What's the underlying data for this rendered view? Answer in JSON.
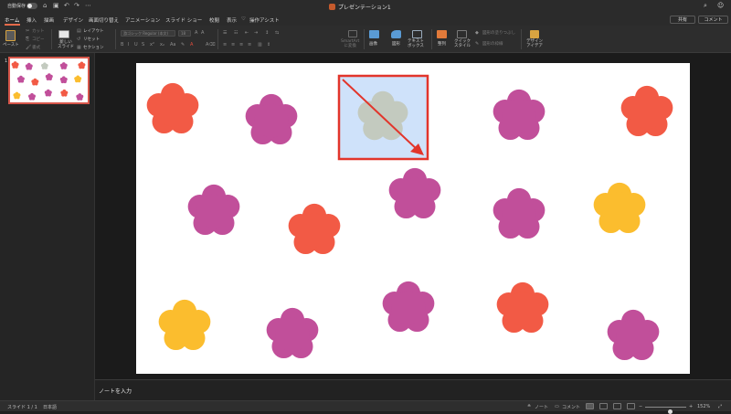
{
  "titlebar": {
    "autosave_label": "自動保存",
    "autosave_state": "オフ",
    "doc_title": "プレゼンテーション1",
    "icons": [
      "home-icon",
      "save-icon",
      "undo-icon",
      "redo-icon",
      "more-icon"
    ]
  },
  "tabs": [
    {
      "label": "ホーム",
      "active": true
    },
    {
      "label": "挿入",
      "active": false
    },
    {
      "label": "描画",
      "active": false
    },
    {
      "label": "デザイン",
      "active": false
    },
    {
      "label": "画面切り替え",
      "active": false
    },
    {
      "label": "アニメーション",
      "active": false
    },
    {
      "label": "スライド ショー",
      "active": false
    },
    {
      "label": "校閲",
      "active": false
    },
    {
      "label": "表示",
      "active": false
    },
    {
      "label": "操作アシスト",
      "active": false
    }
  ],
  "share": {
    "share_label": "共有",
    "comment_label": "コメント"
  },
  "ribbon": {
    "paste": "ペースト",
    "cut": "カット",
    "copy": "コピー",
    "format": "書式",
    "new_slide": "新しい\nスライド",
    "layout": "レイアウト",
    "reset": "リセット",
    "section": "セクション",
    "font_name": "游ゴシック Regular (本文)",
    "font_size": "18",
    "smartart": "SmartArt\nに変換",
    "image": "画像",
    "shape": "図形",
    "textbox": "テキスト\nボックス",
    "arrange": "整列",
    "quick_style": "クイック\nスタイル",
    "shape_fill": "図形の塗りつぶし",
    "shape_outline": "図形の枠線",
    "design_ideas": "デザイン\nアイデア"
  },
  "thumbnail": {
    "number": "1"
  },
  "slide": {
    "flowers": [
      {
        "color": "#f25a45"
      },
      {
        "color": "#c14f9a"
      },
      {
        "color": "#c14f9a"
      },
      {
        "color": "#f25a45"
      },
      {
        "color": "#c14f9a"
      },
      {
        "color": "#f25a45"
      },
      {
        "color": "#c14f9a"
      },
      {
        "color": "#c14f9a"
      },
      {
        "color": "#fbbd2e"
      },
      {
        "color": "#fbbd2e"
      },
      {
        "color": "#c14f9a"
      },
      {
        "color": "#c14f9a"
      },
      {
        "color": "#f25a45"
      },
      {
        "color": "#c14f9a"
      }
    ],
    "selected_flower_color": "#c3cabf",
    "selection_fill": "#cfe2fa",
    "selection_border": "#e2352b",
    "arrow_color": "#e2352b"
  },
  "notes": {
    "placeholder": "ノートを入力"
  },
  "status": {
    "slide_counter": "スライド 1 / 1",
    "language": "日本語",
    "notes_label": "ノート",
    "comments_label": "コメント",
    "zoom": "152%",
    "zoom_fraction": 0.62
  },
  "colors": {
    "accent": "#e56a4a",
    "ribbon_bg": "#2d2d2d",
    "app_bg": "#1f1f1f"
  }
}
